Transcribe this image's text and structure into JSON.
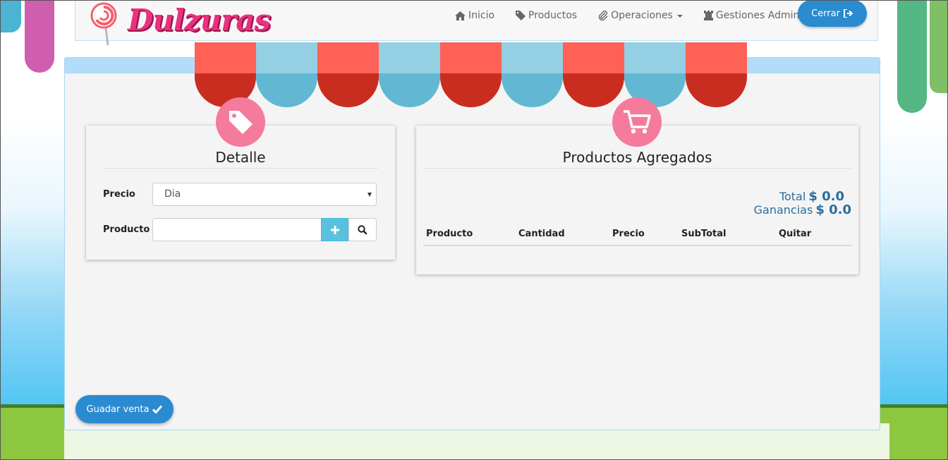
{
  "brand": {
    "logo_text": "Dulzuras",
    "logo_icon": "lollipop-icon"
  },
  "nav": {
    "items": [
      {
        "label": "Inicio",
        "icon": "home-icon",
        "dropdown": false
      },
      {
        "label": "Productos",
        "icon": "tag-icon",
        "dropdown": false
      },
      {
        "label": "Operaciones",
        "icon": "paperclip-icon",
        "dropdown": true
      },
      {
        "label": "Gestiones Admin",
        "icon": "rook-icon",
        "dropdown": true
      }
    ],
    "logout_label": "Cerrar",
    "logout_icon": "sign-out-icon"
  },
  "detalle": {
    "title": "Detalle",
    "icon": "tag-icon",
    "precio_label": "Precio",
    "precio_value": "Dia",
    "producto_label": "Producto",
    "producto_value": "",
    "add_icon": "plus-icon",
    "search_icon": "search-icon"
  },
  "productos_agregados": {
    "title": "Productos Agregados",
    "icon": "shopping-cart-icon",
    "total_label": "Total",
    "total_value": "$ 0.0",
    "ganancias_label": "Ganancias",
    "ganancias_value": "$ 0.0",
    "columns": [
      "Producto",
      "Cantidad",
      "Precio",
      "SubTotal",
      "Quitar"
    ],
    "rows": []
  },
  "actions": {
    "save_label": "Guadar venta",
    "save_icon": "check-icon"
  },
  "colors": {
    "primary": "#2a8bd0",
    "accent_pink": "#f47b9c",
    "info": "#5bc0de",
    "total_text": "#2b6e9b",
    "awning_red": "#ff6157",
    "awning_blue": "#94cfe3"
  }
}
